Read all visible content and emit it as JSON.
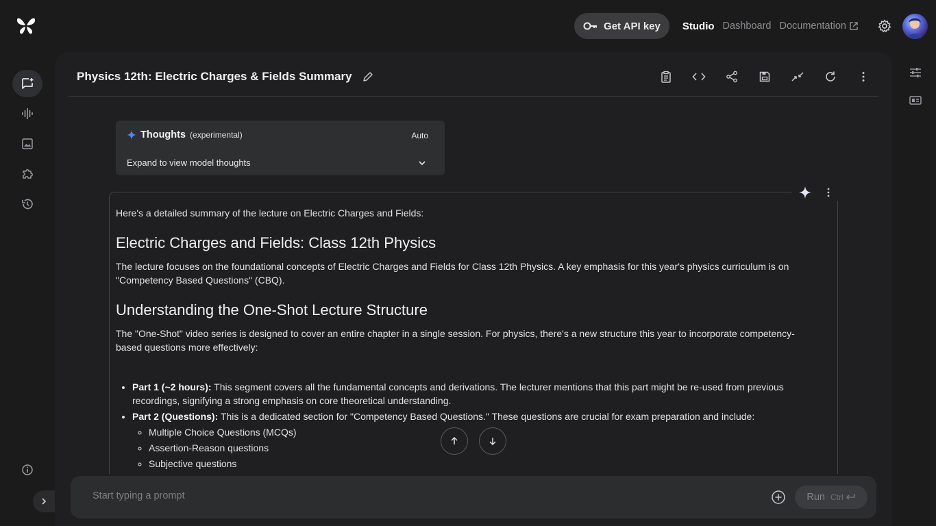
{
  "header": {
    "logo": "butterfly-logo",
    "api_key_label": "Get API key",
    "nav": {
      "studio": "Studio",
      "dashboard": "Dashboard",
      "documentation": "Documentation"
    }
  },
  "sidebar": {
    "items": [
      {
        "icon": "chat-icon",
        "active": true
      },
      {
        "icon": "audio-icon"
      },
      {
        "icon": "image-icon"
      },
      {
        "icon": "puzzle-icon"
      },
      {
        "icon": "history-icon"
      }
    ]
  },
  "main": {
    "title": "Physics 12th: Electric Charges & Fields Summary",
    "thoughts": {
      "title": "Thoughts",
      "subtitle": "(experimental)",
      "mode": "Auto",
      "expand_label": "Expand to view model thoughts"
    },
    "response": {
      "intro": "Here's a detailed summary of the lecture on Electric Charges and Fields:",
      "h1": "Electric Charges and Fields: Class 12th Physics",
      "p1": "The lecture focuses on the foundational concepts of Electric Charges and Fields for Class 12th Physics. A key emphasis for this year's physics curriculum is on \"Competency Based Questions\" (CBQ).",
      "h2": "Understanding the One-Shot Lecture Structure",
      "p2": "The \"One-Shot\" video series is designed to cover an entire chapter in a single session. For physics, there's a new structure this year to incorporate competency-based questions more effectively:",
      "bullets": [
        {
          "label": "Part 1 (~2 hours):",
          "text": " This segment covers all the fundamental concepts and derivations. The lecturer mentions that this part might be re-used from previous recordings, signifying a strong emphasis on core theoretical understanding."
        },
        {
          "label": "Part 2 (Questions):",
          "text": " This is a dedicated section for \"Competency Based Questions.\" These questions are crucial for exam preparation and include:"
        }
      ],
      "sub_bullets": [
        "Multiple Choice Questions (MCQs)",
        "Assertion-Reason questions",
        "Subjective questions"
      ]
    }
  },
  "input": {
    "placeholder": "Start typing a prompt",
    "run_label": "Run",
    "run_shortcut": "Ctrl"
  },
  "colors": {
    "background": "#1b1b1c",
    "panel": "#1f1f21",
    "accent_sparkle": "#4b8af5"
  }
}
